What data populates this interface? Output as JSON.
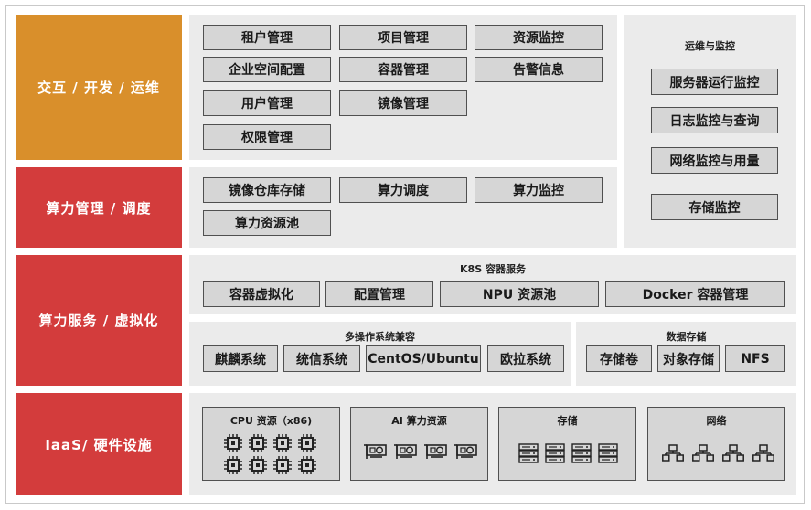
{
  "layers": {
    "interaction": "交互 / 开发 / 运维",
    "compute_mgmt": "算力管理 / 调度",
    "compute_service": "算力服务 / 虚拟化",
    "iaas": "IaaS/ 硬件设施"
  },
  "interaction_boxes": [
    "租户管理",
    "项目管理",
    "资源监控",
    "企业空间配置",
    "容器管理",
    "告警信息",
    "用户管理",
    "镜像管理",
    "权限管理"
  ],
  "ops_monitor": {
    "title": "运维与监控",
    "items": [
      "服务器运行监控",
      "日志监控与查询",
      "网络监控与用量",
      "存储监控"
    ]
  },
  "compute_mgmt_boxes": [
    "镜像仓库存储",
    "算力调度",
    "算力监控",
    "算力资源池"
  ],
  "k8s": {
    "title": "K8S 容器服务",
    "items": [
      "容器虚拟化",
      "配置管理",
      "NPU 资源池",
      "Docker 容器管理"
    ]
  },
  "os_compat": {
    "title": "多操作系统兼容",
    "items": [
      "麒麟系统",
      "统信系统",
      "CentOS/Ubuntu",
      "欧拉系统"
    ]
  },
  "data_storage": {
    "title": "数据存储",
    "items": [
      "存储卷",
      "对象存储",
      "NFS"
    ]
  },
  "hardware": [
    {
      "title": "CPU 资源（x86)",
      "icon": "cpu-chip-icon",
      "count": 8
    },
    {
      "title": "AI 算力资源",
      "icon": "gpu-card-icon",
      "count": 4
    },
    {
      "title": "存储",
      "icon": "storage-server-icon",
      "count": 4
    },
    {
      "title": "网络",
      "icon": "network-topology-icon",
      "count": 4
    }
  ],
  "colors": {
    "orange": "#d98f2b",
    "red": "#d33c3c",
    "panel": "#ebebeb",
    "box": "#d6d6d6"
  }
}
